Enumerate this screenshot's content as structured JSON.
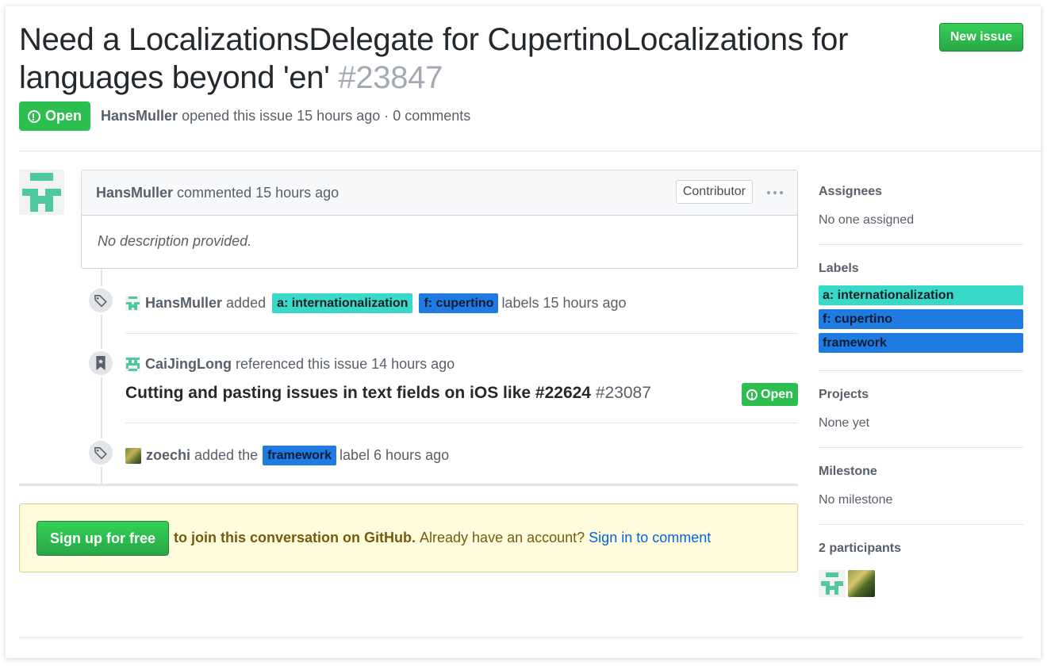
{
  "issue": {
    "title": "Need a LocalizationsDelegate for CupertinoLocalizations for languages beyond 'en'",
    "number": "#23847",
    "state": "Open",
    "author": "HansMuller",
    "opened_text": "opened this issue 15 hours ago · 0 comments"
  },
  "header": {
    "new_issue_label": "New issue"
  },
  "comment": {
    "author": "HansMuller",
    "action_text": "commented 15 hours ago",
    "role_badge": "Contributor",
    "body": "No description provided."
  },
  "timeline": {
    "label_event": {
      "actor": "HansMuller",
      "verb": "added",
      "labels": [
        "a: internationalization",
        "f: cupertino"
      ],
      "suffix": "labels 15 hours ago"
    },
    "reference_event": {
      "actor": "CaiJingLong",
      "text": "referenced this issue 14 hours ago",
      "ref_title": "Cutting and pasting issues in text fields on iOS like #22624",
      "ref_number": "#23087",
      "ref_state": "Open"
    },
    "label_event_2": {
      "actor": "zoechi",
      "verb": "added the",
      "label": "framework",
      "suffix": "label 6 hours ago"
    }
  },
  "signup": {
    "button_label": "Sign up for free",
    "bold_text": "to join this conversation on GitHub.",
    "plain_text": "Already have an account?",
    "link_text": "Sign in to comment"
  },
  "sidebar": {
    "assignees": {
      "heading": "Assignees",
      "value": "No one assigned"
    },
    "labels": {
      "heading": "Labels",
      "items": [
        "a: internationalization",
        "f: cupertino",
        "framework"
      ]
    },
    "projects": {
      "heading": "Projects",
      "value": "None yet"
    },
    "milestone": {
      "heading": "Milestone",
      "value": "No milestone"
    },
    "participants": {
      "heading": "2 participants"
    }
  },
  "colors": {
    "open_green": "#2cbe4e",
    "label_internationalization": "#38d9c9",
    "label_blue": "#1f7be2",
    "link_blue": "#0366d6",
    "signup_bg": "#fffbdd"
  }
}
